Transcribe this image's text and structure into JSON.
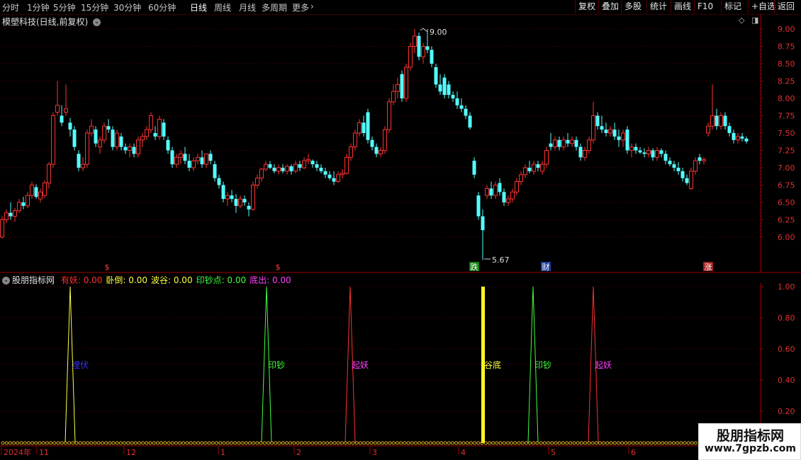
{
  "toolbar": {
    "timeframes": [
      "分时",
      "1分钟",
      "5分钟",
      "15分钟",
      "30分钟",
      "60分钟",
      "日线",
      "周线",
      "月线",
      "多周期",
      "更多"
    ],
    "active_timeframe": "日线",
    "more_glyph": "›",
    "right_buttons": [
      "复权",
      "叠加",
      "多股",
      "统计",
      "画线",
      "F10",
      "标记",
      "+自选",
      "返回"
    ]
  },
  "main_panel": {
    "title": "模塑科技(日线,前复权)",
    "price_high_label": "9.00",
    "price_low_label": "5.67",
    "event_markers": [
      "$",
      "$",
      "跌",
      "财",
      "涨"
    ],
    "y_ticks": [
      "9.00",
      "8.75",
      "8.50",
      "8.25",
      "8.00",
      "7.75",
      "7.50",
      "7.25",
      "7.00",
      "6.75",
      "6.50",
      "6.25",
      "6.00"
    ]
  },
  "indicator_panel": {
    "name": "股朋指标网",
    "legend": [
      {
        "label": "有妖:",
        "value": "0.00",
        "color": "#ff3030"
      },
      {
        "label": "卧倒:",
        "value": "0.00",
        "color": "#ffff40"
      },
      {
        "label": "波谷:",
        "value": "0.00",
        "color": "#ffff40"
      },
      {
        "label": "印钞点:",
        "value": "0.00",
        "color": "#40ff40"
      },
      {
        "label": "底出:",
        "value": "0.00",
        "color": "#ff40ff"
      }
    ],
    "spike_labels": [
      {
        "text": "埋伏",
        "color": "#3030ff"
      },
      {
        "text": "印钞",
        "color": "#40ff40"
      },
      {
        "text": "起妖",
        "color": "#ff40ff"
      },
      {
        "text": "谷底",
        "color": "#ffff40"
      },
      {
        "text": "印钞",
        "color": "#40ff40"
      },
      {
        "text": "起妖",
        "color": "#ff40ff"
      }
    ],
    "y_ticks": [
      "1.00",
      "0.80",
      "0.60",
      "0.40",
      "0.20"
    ]
  },
  "date_axis": {
    "labels": [
      "2024年",
      "11",
      "12",
      "1",
      "2",
      "3",
      "4",
      "5",
      "6"
    ]
  },
  "watermark": {
    "title": "股朋指标网",
    "url": "www.7gpzb.com"
  },
  "colors": {
    "up": "#ff3232",
    "down": "#54ffff",
    "grid": "#5a0000",
    "axis": "#a00000"
  }
}
